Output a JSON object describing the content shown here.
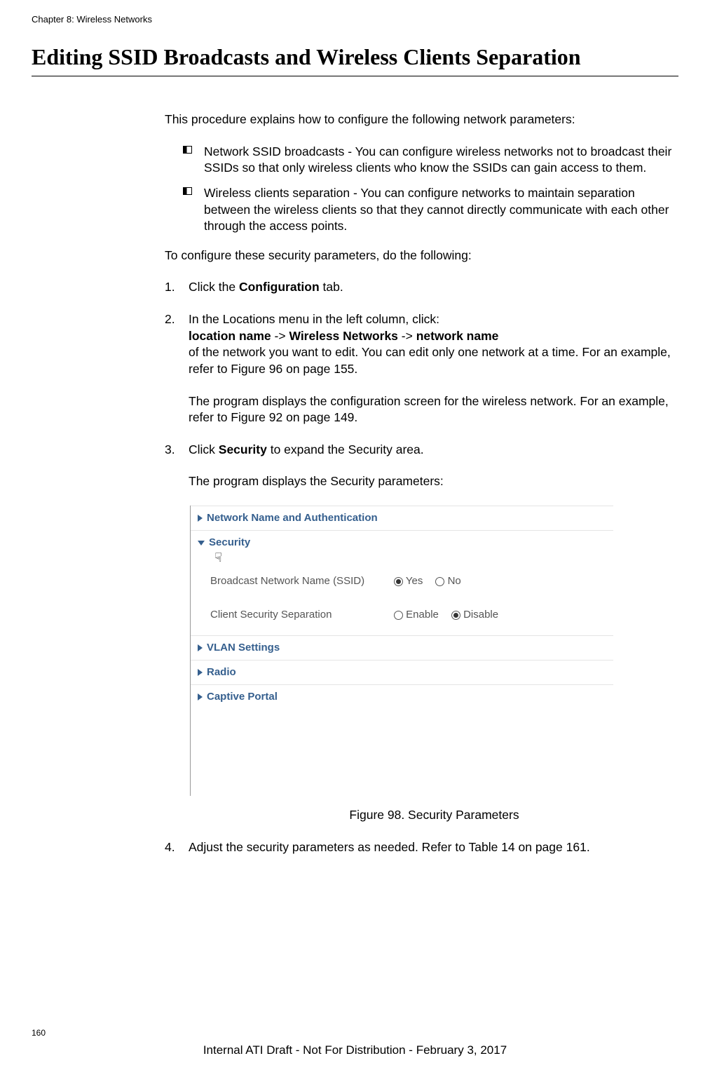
{
  "chapter_header": "Chapter 8: Wireless Networks",
  "section_title": "Editing SSID Broadcasts and Wireless Clients Separation",
  "intro_para": "This procedure explains how to configure the following network parameters:",
  "bullets": {
    "b1": "Network SSID broadcasts - You can configure wireless networks not to broadcast their SSIDs so that only wireless clients who know the SSIDs can gain access to them.",
    "b2": "Wireless clients separation - You can configure networks to maintain separation between the wireless clients so that they cannot directly communicate with each other through the access points."
  },
  "pre_steps": "To configure these security parameters, do the following:",
  "steps": {
    "s1_num": "1.",
    "s1_pre": "Click the ",
    "s1_bold": "Configuration",
    "s1_post": " tab.",
    "s2_num": "2.",
    "s2_line1_pre": "In the Locations menu in the left column, click:",
    "s2_line2_b1": "location name",
    "s2_line2_t1": " -> ",
    "s2_line2_b2": "Wireless Networks",
    "s2_line2_t2": " -> ",
    "s2_line2_b3": "network name",
    "s2_line3": "of the network you want to edit. You can edit only one network at a time. For an example, refer to Figure 96 on page 155.",
    "s2_sub": "The program displays the configuration screen for the wireless network. For an example, refer to Figure 92 on page 149.",
    "s3_num": "3.",
    "s3_pre": "Click ",
    "s3_bold": "Security",
    "s3_post": " to expand the Security area.",
    "s3_sub": "The program displays the Security parameters:",
    "s4_num": "4.",
    "s4_text": "Adjust the security parameters as needed. Refer to Table 14 on page 161."
  },
  "fig": {
    "acc1": "Network Name and Authentication",
    "acc2": "Security",
    "row1_label": "Broadcast Network Name (SSID)",
    "row1_opt1": "Yes",
    "row1_opt2": "No",
    "row2_label": "Client Security Separation",
    "row2_opt1": "Enable",
    "row2_opt2": "Disable",
    "acc3": "VLAN Settings",
    "acc4": "Radio",
    "acc5": "Captive Portal",
    "caption": "Figure 98. Security Parameters"
  },
  "page_num": "160",
  "footer": "Internal ATI Draft - Not For Distribution - February 3, 2017"
}
